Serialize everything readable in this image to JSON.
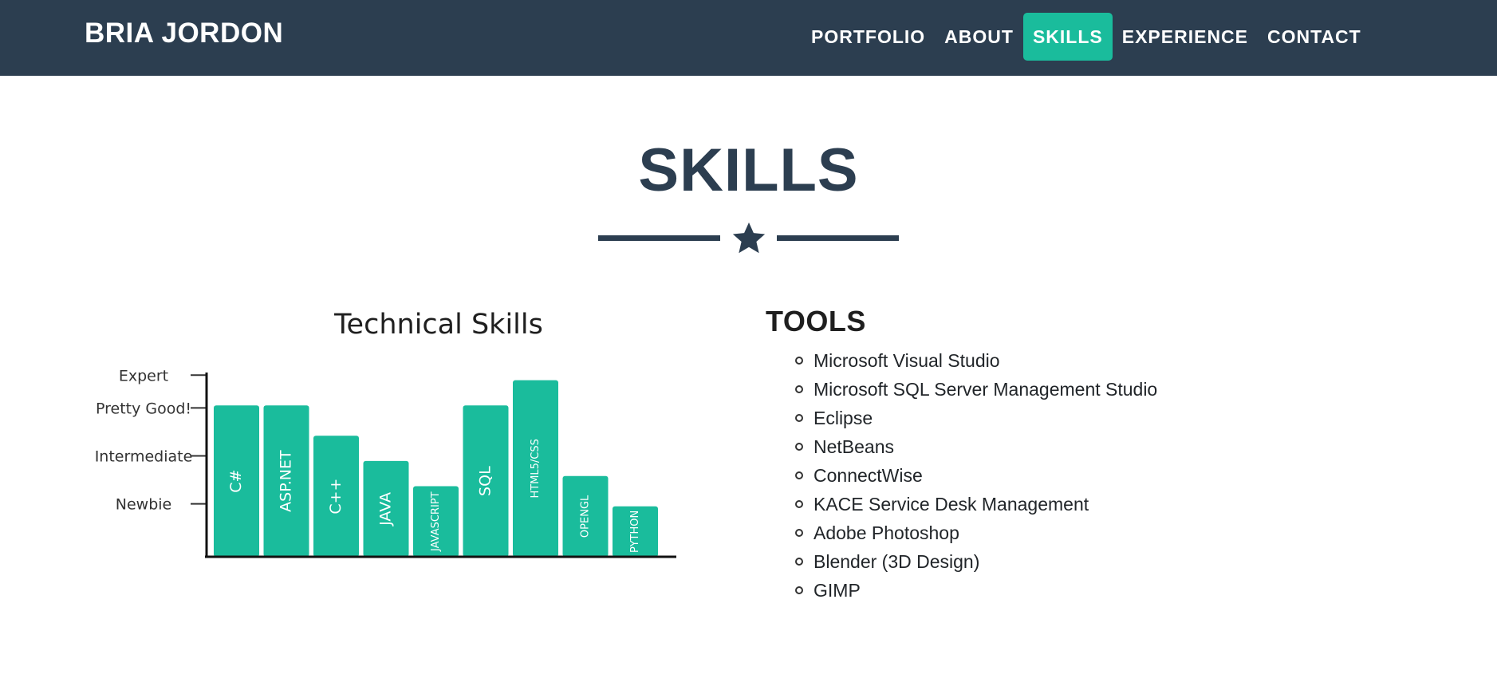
{
  "navbar": {
    "brand": "BRIA JORDON",
    "items": [
      {
        "label": "PORTFOLIO",
        "active": false
      },
      {
        "label": "ABOUT",
        "active": false
      },
      {
        "label": "SKILLS",
        "active": true
      },
      {
        "label": "EXPERIENCE",
        "active": false
      },
      {
        "label": "CONTACT",
        "active": false
      }
    ]
  },
  "colors": {
    "navbar_bg": "#2c3e50",
    "accent": "#1abc9c",
    "heading": "#2c3e50"
  },
  "section": {
    "title": "SKILLS",
    "divider_icon": "star-icon"
  },
  "tools": {
    "heading": "TOOLS",
    "items": [
      "Microsoft Visual Studio",
      "Microsoft SQL Server Management Studio",
      "Eclipse",
      "NetBeans",
      "ConnectWise",
      "KACE Service Desk Management",
      "Adobe Photoshop",
      "Blender (3D Design)",
      "GIMP"
    ]
  },
  "chart_data": {
    "type": "bar",
    "title": "Technical Skills",
    "xlabel": "",
    "ylabel": "",
    "y_ticks": [
      "Newbie",
      "Intermediate",
      "Pretty Good!",
      "Expert"
    ],
    "ylim": [
      0,
      4
    ],
    "categories": [
      "C#",
      "ASP.NET",
      "C++",
      "JAVA",
      "JAVASCRIPT",
      "SQL",
      "HTML5/CSS",
      "OPENGL",
      "PYTHON"
    ],
    "values": [
      3.0,
      3.0,
      2.4,
      1.9,
      1.4,
      3.0,
      3.5,
      1.6,
      1.0
    ],
    "bar_color": "#1abc9c",
    "grid": false,
    "legend": "none"
  }
}
